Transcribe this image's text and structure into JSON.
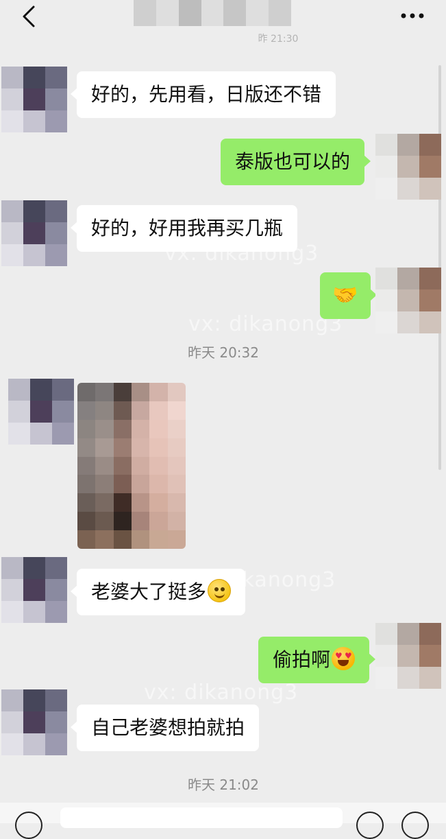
{
  "header": {
    "back_icon": "chevron-left-icon",
    "more_icon": "ellipsis-icon",
    "top_time_partial": "昨 21:30"
  },
  "watermark": "vx: dikanong3",
  "messages": [
    {
      "side": "in",
      "text": "好的，先用看，日版还不错"
    },
    {
      "side": "out",
      "text": "泰版也可以的"
    },
    {
      "side": "in",
      "text": "好的，好用我再买几瓶"
    },
    {
      "side": "out",
      "emoji": "handshake",
      "text": "🤝"
    },
    {
      "time": "昨天 20:32"
    },
    {
      "side": "in",
      "type": "image",
      "description_icon": "photo-thumbnail"
    },
    {
      "side": "in",
      "text": "老婆大了挺多",
      "emoji": "smile"
    },
    {
      "side": "out",
      "text": "偷拍啊",
      "emoji": "heart-eyes"
    },
    {
      "side": "in",
      "text": "自己老婆想拍就拍"
    },
    {
      "time": "昨天 21:02"
    }
  ],
  "bottom": {
    "voice_icon": "voice-icon",
    "emoji_icon": "emoji-icon",
    "plus_icon": "plus-icon"
  }
}
